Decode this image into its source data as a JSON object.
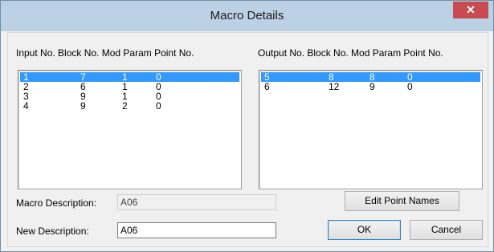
{
  "window": {
    "title": "Macro Details",
    "close_glyph": "✕"
  },
  "inputs": {
    "header": "Input No. Block No. Mod Param Point No.",
    "rows": [
      [
        "1",
        "7",
        "1",
        "0"
      ],
      [
        "2",
        "6",
        "1",
        "0"
      ],
      [
        "3",
        "9",
        "1",
        "0"
      ],
      [
        "4",
        "9",
        "2",
        "0"
      ]
    ],
    "selected_index": 0
  },
  "outputs": {
    "header": "Output No. Block No. Mod Param Point No.",
    "rows": [
      [
        "5",
        "8",
        "8",
        "0"
      ],
      [
        "6",
        "12",
        "9",
        "0"
      ]
    ],
    "selected_index": 0
  },
  "macro_description": {
    "label": "Macro Description:",
    "value": "A06"
  },
  "new_description": {
    "label": "New Description:",
    "value": "A06"
  },
  "buttons": {
    "edit_point_names": "Edit Point Names",
    "ok": "OK",
    "cancel": "Cancel"
  },
  "colors": {
    "selection": "#3399ff",
    "titlebar": "#bcd2e4",
    "close": "#c74b50"
  },
  "icons": {
    "close": "close-icon"
  }
}
